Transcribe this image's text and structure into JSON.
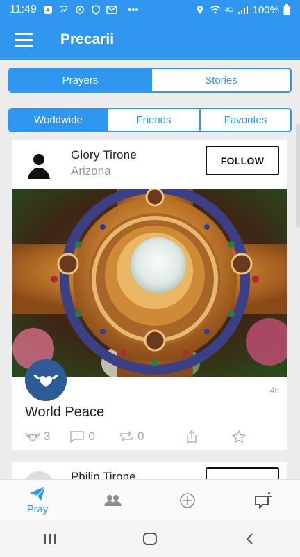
{
  "status_bar": {
    "time": "11:49",
    "battery": "100%",
    "overflow": "•••",
    "network": "4G"
  },
  "app_bar": {
    "title": "Precarii"
  },
  "content_tabs": [
    {
      "label": "Prayers",
      "active": true
    },
    {
      "label": "Stories",
      "active": false
    }
  ],
  "filter_tabs": [
    {
      "label": "Worldwide",
      "active": true
    },
    {
      "label": "Friends",
      "active": false
    },
    {
      "label": "Favorites",
      "active": false
    }
  ],
  "post": {
    "user_name": "Glory Tirone",
    "location": "Arizona",
    "follow_label": "FOLLOW",
    "age": "4h",
    "title": "World Peace",
    "likes": "3",
    "comments": "0",
    "reposts": "0"
  },
  "next_post": {
    "user_name": "Philip Tirone"
  },
  "bottom_tabs": [
    {
      "icon": "paper-plane-icon",
      "label": "Pray"
    },
    {
      "icon": "group-icon"
    },
    {
      "icon": "plus-circle-icon"
    },
    {
      "icon": "notification-icon"
    }
  ],
  "colors": {
    "accent": "#2f97f0",
    "badge": "#2c5b95",
    "muted": "#a7a7a7"
  }
}
